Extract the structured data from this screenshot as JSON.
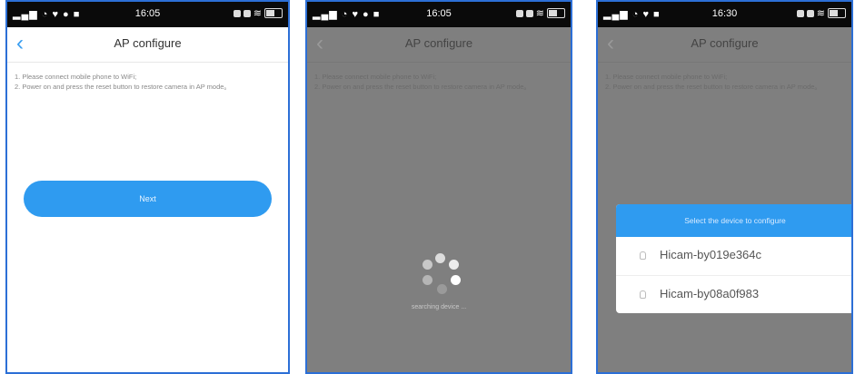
{
  "status_bar": {
    "time": "16:05",
    "time_p3": "16:30"
  },
  "header": {
    "title": "AP configure"
  },
  "instructions": {
    "line1": "1. Please connect mobile phone to WiFi;",
    "line2": "2. Power on and press the reset button to restore camera in AP mode。"
  },
  "next_button": {
    "label": "Next"
  },
  "searching": {
    "text": "searching device ..."
  },
  "device_dialog": {
    "title": "Select the device to configure",
    "devices": [
      "Hicam-by019e364c",
      "Hicam-by08a0f983"
    ]
  }
}
